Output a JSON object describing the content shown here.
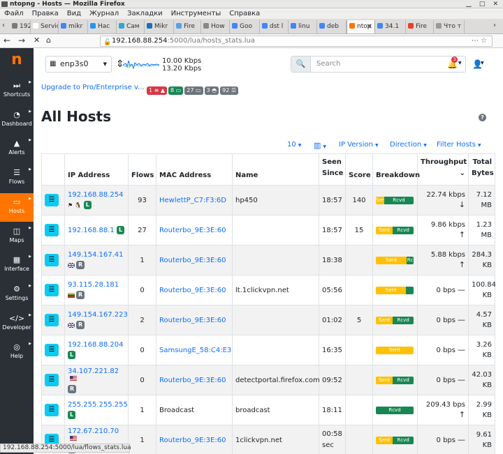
{
  "window": {
    "title": "ntopng - Hosts — Mozilla Firefox"
  },
  "menu": [
    "Файл",
    "Правка",
    "Вид",
    "Журнал",
    "Закладки",
    "Инструменты",
    "Справка"
  ],
  "tabs": [
    {
      "label": "192",
      "color": "#7a7a7a"
    },
    {
      "label": "Service",
      "color": "#ffffff"
    },
    {
      "label": "mikr",
      "color": "#4285f4"
    },
    {
      "label": "Нас",
      "color": "#2196f3"
    },
    {
      "label": "Сам",
      "color": "#2aa8d6"
    },
    {
      "label": "Mikr",
      "color": "#1e6fb8"
    },
    {
      "label": "Fire",
      "color": "#5aa0e6"
    },
    {
      "label": "How",
      "color": "#888888"
    },
    {
      "label": "Goo",
      "color": "#4285f4"
    },
    {
      "label": "dst l",
      "color": "#4285f4"
    },
    {
      "label": "linu",
      "color": "#4285f4"
    },
    {
      "label": "deb",
      "color": "#4285f4"
    },
    {
      "label": "ntop",
      "color": "#ff7500"
    },
    {
      "label": "34.1",
      "color": "#4285f4"
    },
    {
      "label": "Fire",
      "color": "#e0452b"
    },
    {
      "label": "Что т",
      "color": "#999999"
    }
  ],
  "url": {
    "host": "192.168.88.254",
    "path": ":5000/lua/hosts_stats.lua"
  },
  "sidebar": [
    {
      "label": "Shortcuts",
      "icon": "play-icon"
    },
    {
      "label": "Dashboard",
      "icon": "gauge-icon"
    },
    {
      "label": "Alerts",
      "icon": "warning-icon"
    },
    {
      "label": "Flows",
      "icon": "stream-icon"
    },
    {
      "label": "Hosts",
      "icon": "laptop-icon"
    },
    {
      "label": "Maps",
      "icon": "map-icon"
    },
    {
      "label": "Interface",
      "icon": "ethernet-icon"
    },
    {
      "label": "Settings",
      "icon": "gear-icon"
    },
    {
      "label": "Developer",
      "icon": "code-icon"
    },
    {
      "label": "Help",
      "icon": "lifebuoy-icon"
    }
  ],
  "header": {
    "interface": "enp3s0",
    "upload": "10.00 Kbps",
    "download": "13.20 Kbps",
    "search_placeholder": "Search",
    "alerts_count": "3"
  },
  "upgrade_link": "Upgrade to Pro/Enterprise v...",
  "status_badges": [
    {
      "text": "1 ≡ ▲",
      "color": "red"
    },
    {
      "text": "8 ▭",
      "color": "green"
    },
    {
      "text": "27 ▭",
      "color": "gray"
    },
    {
      "text": "3 ◓",
      "color": "gray"
    },
    {
      "text": "92 ☰",
      "color": "gray"
    }
  ],
  "page_title": "All Hosts",
  "toolbar": {
    "page_size": "10",
    "ip_version": "IP Version",
    "direction": "Direction",
    "filter_hosts": "Filter Hosts"
  },
  "columns": [
    "IP Address",
    "Flows",
    "MAC Address",
    "Name",
    "Seen Since",
    "Score",
    "Breakdown",
    "Throughput",
    "Total Bytes"
  ],
  "rows": [
    {
      "ip": "192.168.88.254",
      "flag": "",
      "os": "⚑ 🐧",
      "badge": "L",
      "flows": "93",
      "mac": "HewlettP_C7:F3:6D",
      "name": "hp450",
      "seen": "18:57",
      "score": "140",
      "sent": 0.22,
      "rcvd": 0.78,
      "sent_label": "Sent",
      "rcvd_label": "Rcvd",
      "tp": "22.74 kbps",
      "dir": "↓",
      "bytes": "7.12 MB"
    },
    {
      "ip": "192.168.88.1",
      "flag": "",
      "os": "",
      "badge": "L",
      "flows": "27",
      "mac": "Routerbo_9E:3E:60",
      "name": "",
      "seen": "18:57",
      "score": "15",
      "sent": 0.45,
      "rcvd": 0.55,
      "sent_label": "Sent",
      "rcvd_label": "Rcvd",
      "tp": "9.86 kbps",
      "dir": "↑",
      "bytes": "1.23 MB"
    },
    {
      "ip": "149.154.167.41",
      "flag": "gb",
      "os": "",
      "badge": "R",
      "flows": "1",
      "mac": "Routerbo_9E:3E:60",
      "name": "",
      "seen": "18:38",
      "score": "",
      "sent": 0.82,
      "rcvd": 0.18,
      "sent_label": "Sent",
      "rcvd_label": "Rc",
      "tp": "5.88 kbps",
      "dir": "↑",
      "bytes": "284.3 KB"
    },
    {
      "ip": "93.115.28.181",
      "flag": "lt",
      "os": "",
      "badge": "R",
      "flows": "0",
      "mac": "Routerbo_9E:3E:60",
      "name": "lt.1clickvpn.net",
      "seen": "05:56",
      "score": "",
      "sent": 0.8,
      "rcvd": 0.2,
      "sent_label": "Sent",
      "rcvd_label": "",
      "tp": "0 bps",
      "dir": "—",
      "bytes": "100.84 KB"
    },
    {
      "ip": "149.154.167.223",
      "flag": "gb",
      "os": "",
      "badge": "R",
      "flows": "2",
      "mac": "Routerbo_9E:3E:60",
      "name": "",
      "seen": "01:02",
      "score": "5",
      "sent": 0.45,
      "rcvd": 0.55,
      "sent_label": "Sent",
      "rcvd_label": "Rcvd",
      "tp": "0 bps",
      "dir": "—",
      "bytes": "4.57 KB"
    },
    {
      "ip": "192.168.88.204",
      "flag": "",
      "os": "",
      "badge": "L",
      "flows": "0",
      "mac": "SamsungE_58:C4:E3",
      "name": "",
      "seen": "16:35",
      "score": "",
      "sent": 1.0,
      "rcvd": 0.0,
      "sent_label": "Sent",
      "rcvd_label": "",
      "tp": "0 bps",
      "dir": "—",
      "bytes": "3.26 KB"
    },
    {
      "ip": "34.107.221.82",
      "flag": "us",
      "os": "",
      "badge": "R",
      "flows": "0",
      "mac": "Routerbo_9E:3E:60",
      "name": "detectportal.firefox.com",
      "seen": "09:52",
      "score": "",
      "sent": 0.45,
      "rcvd": 0.55,
      "sent_label": "Sent",
      "rcvd_label": "Rcvd",
      "tp": "0 bps",
      "dir": "—",
      "bytes": "42.03 KB"
    },
    {
      "ip": "255.255.255.255",
      "flag": "",
      "os": "",
      "badge": "L",
      "flows": "1",
      "mac": "Broadcast",
      "name": "broadcast",
      "seen": "18:11",
      "score": "",
      "sent": 0.0,
      "rcvd": 1.0,
      "sent_label": "",
      "rcvd_label": "Rcvd",
      "tp": "209.43 bps",
      "dir": "↑",
      "bytes": "2.99 KB"
    },
    {
      "ip": "172.67.210.70",
      "flag": "us",
      "os": "",
      "badge": "R",
      "flows": "1",
      "mac": "Routerbo_9E:3E:60",
      "name": "1clickvpn.net",
      "seen": "00:58 sec",
      "score": "",
      "sent": 0.45,
      "rcvd": 0.55,
      "sent_label": "Sent",
      "rcvd_label": "Rcvd",
      "tp": "0 bps",
      "dir": "—",
      "bytes": "9.61 KB"
    }
  ],
  "statusbar": "192.168.88.254:5000/lua/flows_stats.lua",
  "colors": {
    "accent": "#ff7500",
    "sidebar": "#2b2f36",
    "link": "#0d6efd",
    "sent": "#ffc107",
    "rcvd": "#198754",
    "info_btn": "#0dcaf0"
  }
}
